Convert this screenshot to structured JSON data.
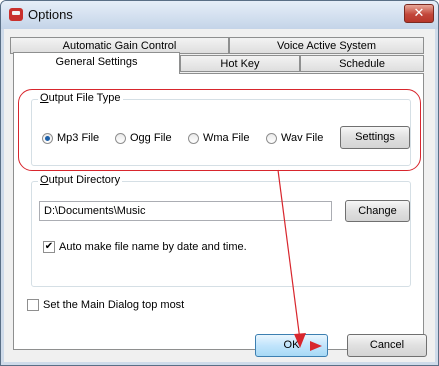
{
  "window": {
    "title": "Options",
    "close_label": "✕"
  },
  "tabs": {
    "row_back": [
      {
        "label": "Automatic Gain Control"
      },
      {
        "label": "Voice Active System"
      }
    ],
    "row_front": [
      {
        "label": "General Settings",
        "selected": true
      },
      {
        "label": "Hot Key"
      },
      {
        "label": "Schedule"
      }
    ]
  },
  "output_file_type": {
    "group_label": "Output File Type",
    "options": [
      {
        "label": "Mp3 File",
        "checked": true
      },
      {
        "label": "Ogg File",
        "checked": false
      },
      {
        "label": "Wma File",
        "checked": false
      },
      {
        "label": "Wav File",
        "checked": false
      }
    ],
    "settings_label": "Settings"
  },
  "output_directory": {
    "group_label": "Output Directory",
    "path_value": "D:\\Documents\\Music",
    "change_label": "Change",
    "auto_name_label": "Auto make file name by date and time.",
    "auto_name_checked": true
  },
  "main_dialog_top_most": {
    "label": "Set the Main Dialog top most",
    "checked": false
  },
  "footer": {
    "ok_label": "OK",
    "cancel_label": "Cancel"
  },
  "colors": {
    "annotation_red": "#d8262d",
    "accent_blue": "#1c5fa8"
  }
}
